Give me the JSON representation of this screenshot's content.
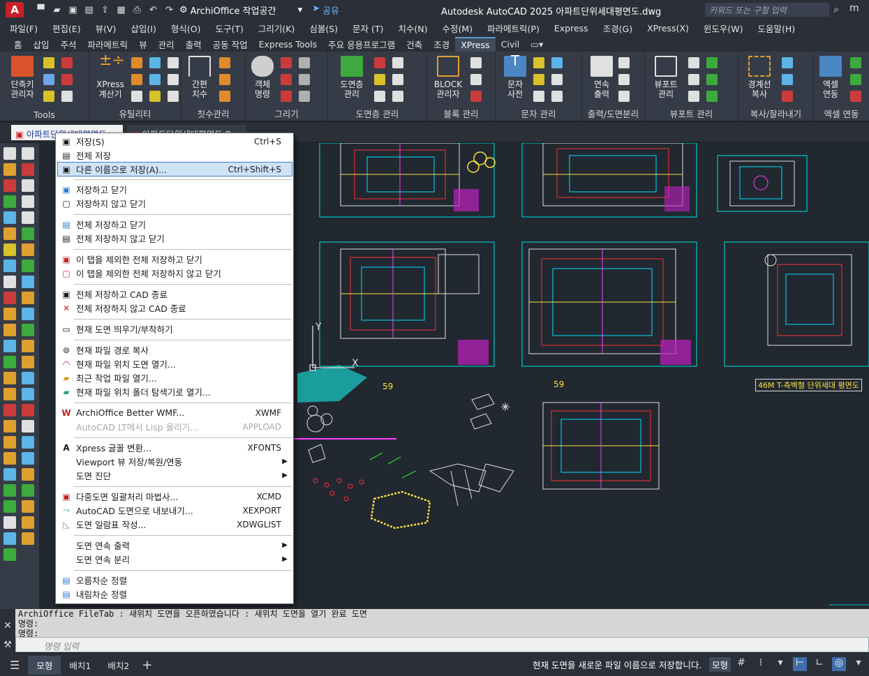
{
  "titlebar": {
    "app_logo": "A",
    "workspace": "ArchiOffice 작업공간",
    "share": "공유",
    "title": "Autodesk AutoCAD 2025    아파트단위세대평면도.dwg",
    "search_placeholder": "키워드 또는 구절 입력"
  },
  "menubar": [
    "파일(F)",
    "편집(E)",
    "뷰(V)",
    "삽입(I)",
    "형식(O)",
    "도구(T)",
    "그리기(K)",
    "심볼(S)",
    "문자 (T)",
    "치수(N)",
    "수정(M)",
    "파라메트릭(P)",
    "Express",
    "조경(G)",
    "XPress(X)",
    "윈도우(W)",
    "도움말(H)"
  ],
  "ribbon_tabs": [
    "홈",
    "삽입",
    "주석",
    "파라메트릭",
    "뷰",
    "관리",
    "출력",
    "공동 작업",
    "Express Tools",
    "주요 응용프로그램",
    "건축",
    "조경",
    "XPress",
    "Civil"
  ],
  "ribbon_active_tab": "XPress",
  "ribbon_groups": [
    {
      "title": "Tools",
      "buttons": [
        "단축키\n관리자"
      ]
    },
    {
      "title": "유틸리티",
      "buttons": [
        "XPress\n계산기"
      ]
    },
    {
      "title": "칫수관리",
      "buttons": [
        "간편\n치수"
      ]
    },
    {
      "title": "그리기",
      "buttons": [
        "객체\n명령"
      ]
    },
    {
      "title": "도면층 관리",
      "buttons": [
        "도면층\n관리"
      ]
    },
    {
      "title": "블록 관리",
      "buttons": [
        "BLOCK\n관리자"
      ]
    },
    {
      "title": "문자 관리",
      "buttons": [
        "문자\n사전"
      ]
    },
    {
      "title": "출력/도면분리",
      "buttons": [
        "연속\n출력"
      ]
    },
    {
      "title": "뷰포트 관리",
      "buttons": [
        "뷰포트\n관리"
      ]
    },
    {
      "title": "복사/잘라내기",
      "buttons": [
        "경계선\n복사"
      ]
    },
    {
      "title": "엑셀 연동",
      "buttons": [
        "엑셀\n연동"
      ]
    }
  ],
  "doc_tabs": [
    "아파트단위세대평면도",
    "아파트단위세대평면도.B"
  ],
  "canvas": {
    "label_59a": "59",
    "label_59b": "59",
    "title_label": "46M T-측벽형 단위세대 평면도"
  },
  "context_menu": {
    "items": [
      {
        "label": "저장(S)",
        "shortcut": "Ctrl+S",
        "icon": "save-icon"
      },
      {
        "label": "전체 저장",
        "shortcut": "",
        "icon": "save-all-icon"
      },
      {
        "label": "다른 이름으로 저장(A)...",
        "shortcut": "Ctrl+Shift+S",
        "icon": "save-as-icon",
        "highlighted": true
      },
      {
        "label": "저장하고 닫기",
        "shortcut": "",
        "icon": "save-close-icon"
      },
      {
        "label": "저장하지 않고 닫기",
        "shortcut": "",
        "icon": "close-nosave-icon"
      },
      {
        "label": "전체 저장하고 닫기",
        "shortcut": "",
        "icon": "save-all-close-icon"
      },
      {
        "label": "전체 저장하지 않고 닫기",
        "shortcut": "",
        "icon": "close-all-nosave-icon"
      },
      {
        "label": "이 탭을 제외한 전체 저장하고 닫기",
        "shortcut": "",
        "icon": "save-others-close-icon"
      },
      {
        "label": "이 탭을 제외한 전체 저장하지 않고 닫기",
        "shortcut": "",
        "icon": "close-others-nosave-icon"
      },
      {
        "label": "전체 저장하고 CAD 종료",
        "shortcut": "",
        "icon": "save-exit-icon"
      },
      {
        "label": "전체 저장하지 않고 CAD 종료",
        "shortcut": "",
        "icon": "exit-nosave-icon"
      },
      {
        "label": "현재 도면 띄우기/부착하기",
        "shortcut": "",
        "icon": "float-dock-icon"
      },
      {
        "label": "현재 파일 경로 복사",
        "shortcut": "",
        "icon": "copy-path-icon"
      },
      {
        "label": "현재 파일 위치 도면 열기...",
        "shortcut": "",
        "icon": "open-location-icon"
      },
      {
        "label": "최근 작업 파일 열기...",
        "shortcut": "",
        "icon": "recent-files-icon"
      },
      {
        "label": "현재 파일 위치 폴더  탐색기로 열기...",
        "shortcut": "",
        "icon": "folder-explorer-icon"
      },
      {
        "label": "ArchiOffice Better WMF...",
        "shortcut": "XWMF",
        "icon": "wmf-icon"
      },
      {
        "label": "AutoCAD LT에서 Lisp 올리기...",
        "shortcut": "APPLOAD",
        "icon": "",
        "disabled": true
      },
      {
        "label": "Xpress 글꼴 변환...",
        "shortcut": "XFONTS",
        "icon": "font-convert-icon"
      },
      {
        "label": "Viewport 뷰 저장/복원/연동",
        "shortcut": "",
        "icon": "",
        "submenu": true
      },
      {
        "label": "도면 진단",
        "shortcut": "",
        "icon": "",
        "submenu": true
      },
      {
        "label": "다중도면 일괄처리 마법사...",
        "shortcut": "XCMD",
        "icon": "batch-wizard-icon"
      },
      {
        "label": "AutoCAD 도면으로 내보내기...",
        "shortcut": "XEXPORT",
        "icon": "export-icon"
      },
      {
        "label": "도면 일람표 작성...",
        "shortcut": "XDWGLIST",
        "icon": "drawing-list-icon"
      },
      {
        "label": "도면 연속 출력",
        "shortcut": "",
        "icon": "",
        "submenu": true
      },
      {
        "label": "도면 연속 분리",
        "shortcut": "",
        "icon": "",
        "submenu": true
      },
      {
        "label": "오름차순 정렬",
        "shortcut": "",
        "icon": "sort-asc-icon"
      },
      {
        "label": "내림차순 정렬",
        "shortcut": "",
        "icon": "sort-desc-icon"
      }
    ]
  },
  "command": {
    "history": [
      "ArchiOffice FileTab : 새위치 도면을 오픈하였습니다 : 새위치 도면을 열기 완료 도면",
      "명령:",
      "명령:"
    ],
    "placeholder": "명령 입력"
  },
  "statusbar": {
    "tabs": [
      "모형",
      "배치1",
      "배치2"
    ],
    "message": "현재 도면을 새로운 파일 이름으로 저장합니다.",
    "model": "모형"
  }
}
